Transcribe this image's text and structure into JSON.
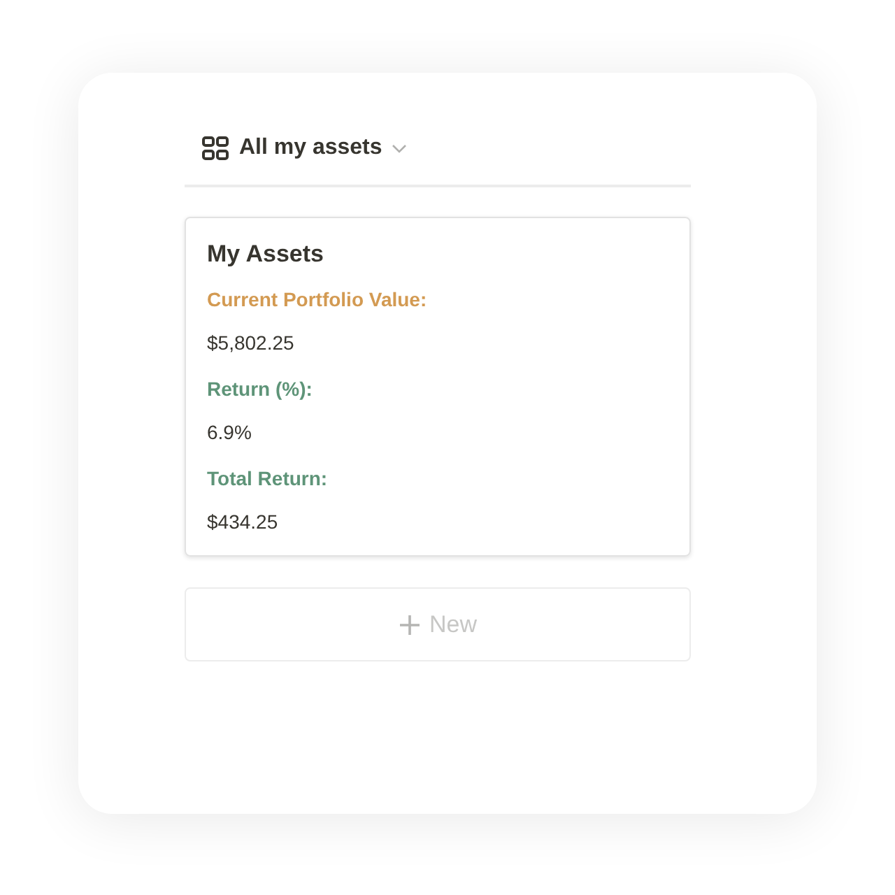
{
  "view": {
    "title": "All my assets"
  },
  "card": {
    "title": "My Assets",
    "fields": [
      {
        "label": "Current Portfolio Value:",
        "value": "$5,802.25",
        "color": "#d39a52"
      },
      {
        "label": "Return (%):",
        "value": "6.9%",
        "color": "#5e9478"
      },
      {
        "label": "Total Return:",
        "value": "$434.25",
        "color": "#5e9478"
      }
    ]
  },
  "new_button": {
    "label": "New"
  }
}
